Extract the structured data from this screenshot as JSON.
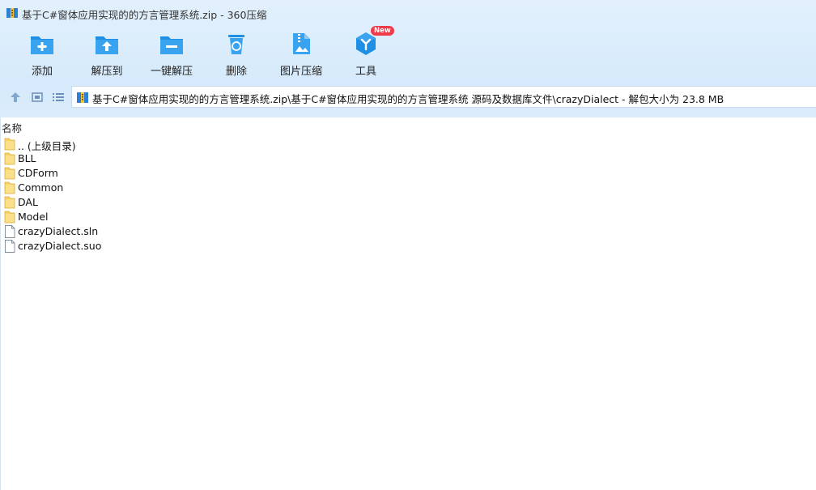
{
  "window": {
    "title": "基于C#窗体应用实现的的方言管理系统.zip - 360压缩"
  },
  "toolbar": {
    "items": [
      {
        "label": "添加",
        "icon": "add-folder-icon"
      },
      {
        "label": "解压到",
        "icon": "extract-to-icon"
      },
      {
        "label": "一键解压",
        "icon": "one-click-extract-icon"
      },
      {
        "label": "删除",
        "icon": "recycle-bin-icon"
      },
      {
        "label": "图片压缩",
        "icon": "image-compress-icon"
      },
      {
        "label": "工具",
        "icon": "tools-icon",
        "badge": "New"
      }
    ]
  },
  "nav": {
    "up_icon": "up-arrow-icon",
    "view_icon": "thumbnail-view-icon",
    "list_icon": "list-view-icon"
  },
  "path": {
    "text": "基于C#窗体应用实现的的方言管理系统.zip\\基于C#窗体应用实现的的方言管理系统 源码及数据库文件\\crazyDialect - 解包大小为 23.8 MB"
  },
  "list": {
    "column_header": "名称",
    "files": [
      {
        "name": ".. (上级目录)",
        "type": "folder"
      },
      {
        "name": "BLL",
        "type": "folder"
      },
      {
        "name": "CDForm",
        "type": "folder"
      },
      {
        "name": "Common",
        "type": "folder"
      },
      {
        "name": "DAL",
        "type": "folder"
      },
      {
        "name": "Model",
        "type": "folder"
      },
      {
        "name": "crazyDialect.sln",
        "type": "file"
      },
      {
        "name": "crazyDialect.suo",
        "type": "file"
      }
    ]
  },
  "colors": {
    "accent": "#1f8fe6",
    "folder": "#f7d36a",
    "badge": "#ef3b4a"
  }
}
